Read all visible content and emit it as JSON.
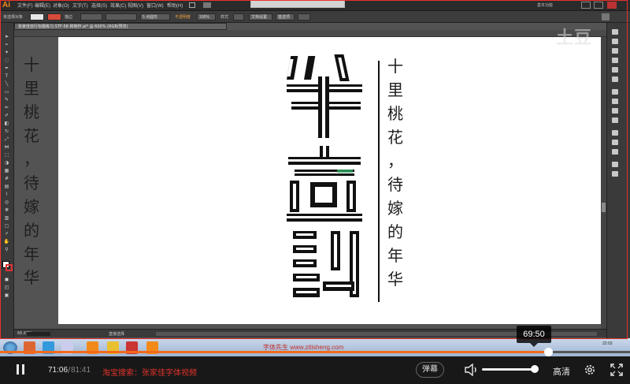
{
  "app": {
    "logo": "Ai",
    "menus": [
      "文件(F)",
      "编辑(E)",
      "对象(O)",
      "文字(T)",
      "选择(S)",
      "效果(C)",
      "视图(V)",
      "窗口(W)",
      "帮助(H)"
    ],
    "workspace": "基本功能",
    "document_tab": "张家佳自行标题练习.STF-58 和制作.ai* @ 600% (RGB/预览)",
    "control_bar": {
      "selection": "未选择对象",
      "stroke_label": "描边",
      "stroke_size": "5 点圆形",
      "opacity_label": "不透明度",
      "opacity_value": "100%",
      "style_label": "样式",
      "doc_setup": "文档设置",
      "preferences": "首选项"
    },
    "status_zoom": "66.67%",
    "status_tool": "直接选择"
  },
  "artwork": {
    "left_column": [
      "十",
      "里",
      "桃",
      "花",
      "，",
      "待",
      "嫁",
      "的",
      "年",
      "华"
    ],
    "right_column": [
      "十",
      "里",
      "桃",
      "花",
      "，",
      "待",
      "嫁",
      "的",
      "年",
      "华"
    ]
  },
  "taskbar": {
    "watermark": "字体先生 www.zitisheng.com",
    "clock": "22:03"
  },
  "player": {
    "current_time": "71:06",
    "total_time": "81:41",
    "hover_time": "69:50",
    "progress": 0.8705,
    "promo": "淘宝搜索：张家佳字体视频",
    "danmaku_label": "弹幕",
    "quality_label": "高清",
    "volume": 0.95,
    "accent_color": "#f26a1b",
    "promo_color": "#e0332a"
  }
}
